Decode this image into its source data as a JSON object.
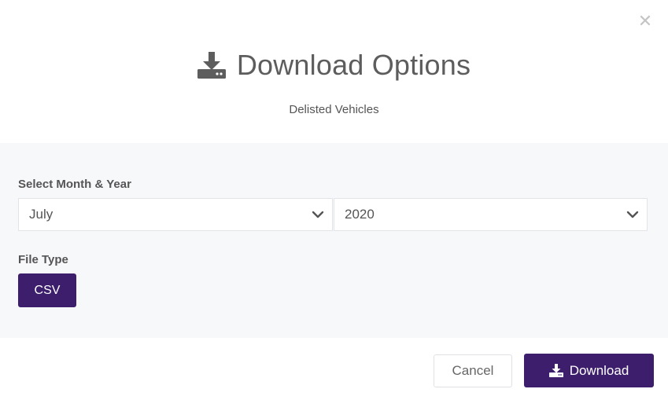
{
  "dialog": {
    "close_icon": "close-icon",
    "title": "Download Options",
    "title_icon": "download-icon",
    "subtitle": "Delisted Vehicles"
  },
  "form": {
    "month_year_label": "Select Month & Year",
    "month_selected": "July",
    "year_selected": "2020",
    "file_type_label": "File Type",
    "file_type_selected": "CSV"
  },
  "footer": {
    "cancel_label": "Cancel",
    "download_label": "Download"
  },
  "colors": {
    "accent": "#3d1e6d",
    "text": "#555555",
    "body_bg": "#f7f8fa"
  }
}
